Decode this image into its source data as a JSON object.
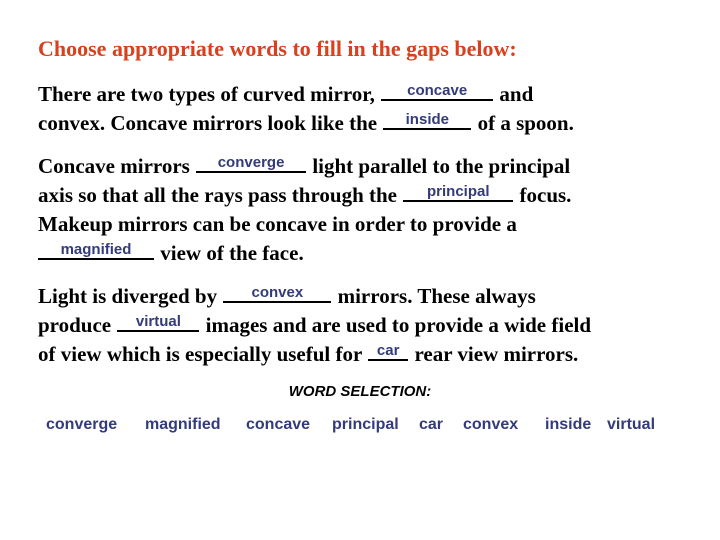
{
  "title": "Choose appropriate words to fill in the gaps below:",
  "paragraphs": [
    {
      "lines": [
        {
          "pre": "There are two types of curved mirror, ",
          "answer": "concave",
          "post": " and"
        },
        {
          "pre": "convex. Concave mirrors look like the ",
          "answer": "inside",
          "post": " of a spoon."
        }
      ]
    },
    {
      "lines": [
        {
          "pre": "Concave mirrors ",
          "answer": "converge",
          "post": " light parallel to the principal"
        },
        {
          "pre": "axis so that all the rays pass through the ",
          "answer": "principal",
          "post": " focus."
        },
        {
          "pre": "Makeup mirrors can be concave in order to provide a",
          "answer": null,
          "post": ""
        },
        {
          "pre": "",
          "answer": "magnified",
          "post": " view of the face."
        }
      ]
    },
    {
      "lines": [
        {
          "pre": "Light is diverged by ",
          "answer": "convex",
          "post": " mirrors. These always"
        },
        {
          "pre": "produce ",
          "answer": "virtual",
          "post": " images and are used to provide a wide field"
        },
        {
          "pre": "of view which is especially useful for ",
          "answer": "car",
          "post": " rear view mirrors."
        }
      ]
    }
  ],
  "word_selection": {
    "title": "WORD SELECTION:",
    "words": [
      "converge",
      "magnified",
      "concave",
      "principal",
      "car",
      "convex",
      "inside",
      "virtual"
    ]
  },
  "colors": {
    "title": "#d9411e",
    "answer": "#333b7a",
    "text": "#000000"
  }
}
